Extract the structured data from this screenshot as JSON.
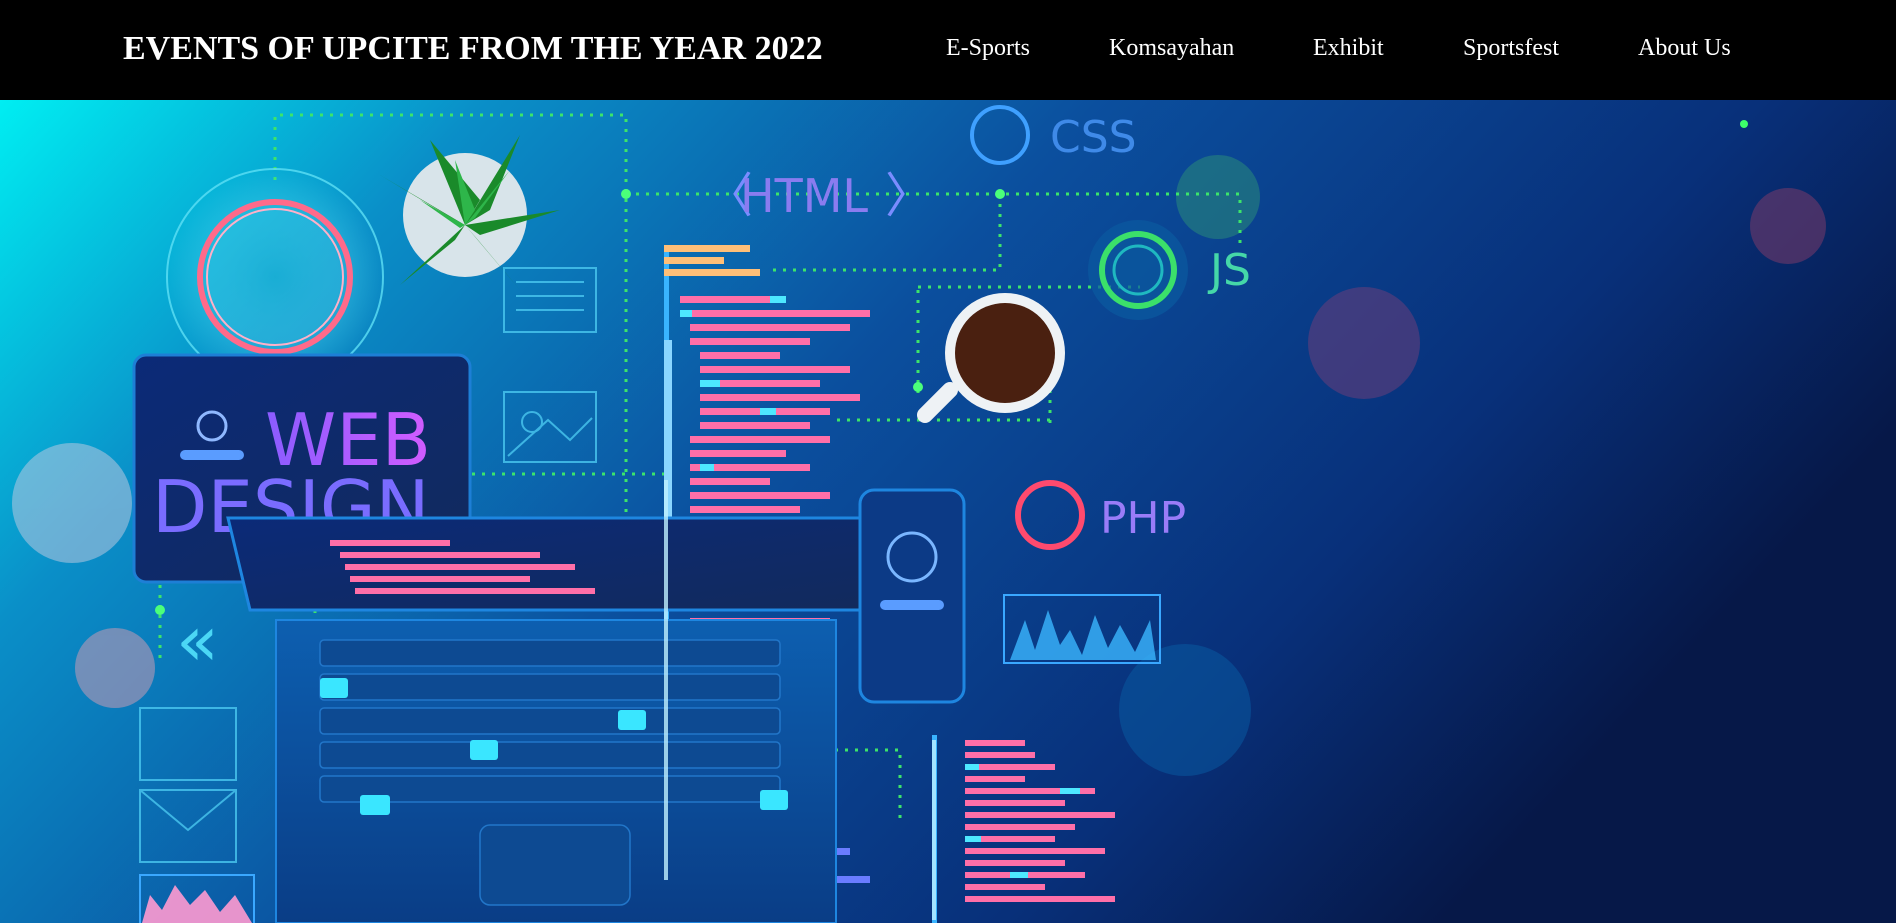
{
  "header": {
    "title": "EVENTS OF UPCITE FROM THE YEAR 2022",
    "nav": [
      {
        "label": "E-Sports"
      },
      {
        "label": "Komsayahan"
      },
      {
        "label": "Exhibit"
      },
      {
        "label": "Sportsfest"
      },
      {
        "label": "About Us"
      }
    ]
  },
  "hero": {
    "labels": {
      "html": "HTML",
      "css": "CSS",
      "js": "JS",
      "php": "PHP",
      "web": "WEB",
      "design": "DESIGN"
    }
  },
  "colors": {
    "topbar": "#000000",
    "hero_left": "#00e5ee",
    "hero_mid": "#0a56a8",
    "hero_right": "#071a4e"
  }
}
